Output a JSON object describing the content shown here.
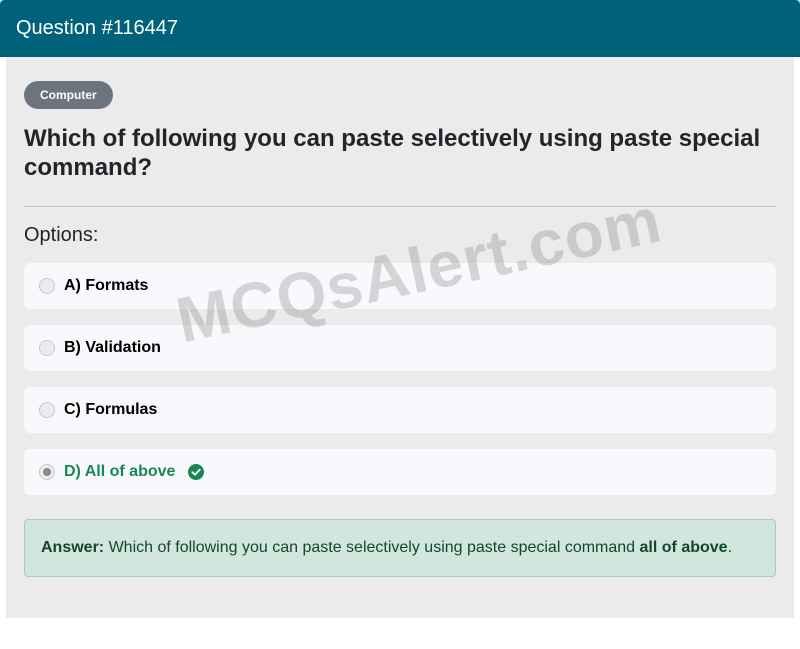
{
  "header": {
    "title": "Question #116447"
  },
  "category_badge": "Computer",
  "question": "Which of following you can paste selectively using paste special command?",
  "options_label": "Options:",
  "options": [
    {
      "label": "A) Formats",
      "selected": false,
      "correct": false
    },
    {
      "label": "B) Validation",
      "selected": false,
      "correct": false
    },
    {
      "label": "C) Formulas",
      "selected": false,
      "correct": false
    },
    {
      "label": "D) All of above",
      "selected": true,
      "correct": true
    }
  ],
  "answer": {
    "prefix": "Answer:",
    "text": "Which of following you can paste selectively using paste special command",
    "highlight": "all of above",
    "suffix": "."
  },
  "watermark": "MCQsAlert.com",
  "colors": {
    "header": "#00627a",
    "correct": "#198754",
    "answer_bg": "#d1e7dd",
    "badge": "#6c757d"
  },
  "icons": {
    "correct_marker": "check-circle-icon"
  }
}
